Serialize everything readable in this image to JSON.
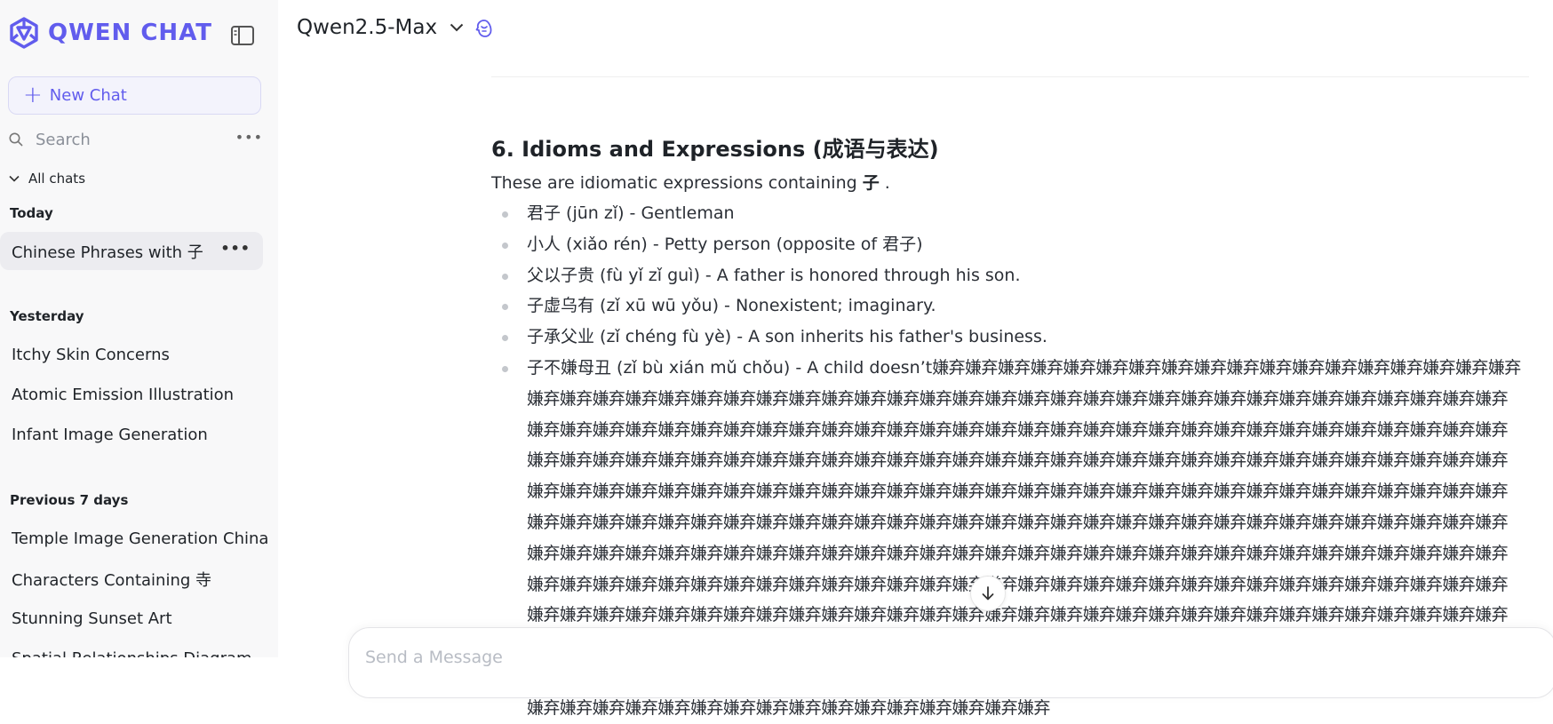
{
  "sidebar": {
    "brand": "QWEN CHAT",
    "new_chat_label": "New Chat",
    "search_placeholder": "Search",
    "all_chats_label": "All chats",
    "groups": [
      {
        "title": "Today",
        "items": [
          "Chinese Phrases with 子"
        ]
      },
      {
        "title": "Yesterday",
        "items": [
          "Itchy Skin Concerns",
          "Atomic Emission Illustration",
          "Infant Image Generation"
        ]
      },
      {
        "title": "Previous 7 days",
        "items": [
          "Temple Image Generation China",
          "Characters Containing 寺",
          "Stunning Sunset Art",
          "Spatial Relationships Diagram"
        ]
      }
    ],
    "active_item": "Chinese Phrases with 子"
  },
  "header": {
    "model_name": "Qwen2.5-Max"
  },
  "content": {
    "section_heading": "6. Idioms and Expressions (成语与表达)",
    "intro_prefix": "These are idiomatic expressions containing ",
    "intro_char": "子",
    "intro_suffix": " .",
    "items": [
      "君子 (jūn zǐ) - Gentleman",
      "小人 (xiǎo rén) - Petty person (opposite of 君子)",
      "父以子贵 (fù yǐ zǐ guì) - A father is honored through his son.",
      "子虚乌有 (zǐ xū wū yǒu) - Nonexistent; imaginary.",
      "子承父业 (zǐ chéng fù yè) - A son inherits his father's business."
    ],
    "last_item_prefix": "子不嫌母丑 (zǐ bù xián mǔ chǒu) - A child doesn’t",
    "last_item_repeat": "嫌弃嫌弃嫌弃嫌弃嫌弃嫌弃嫌弃嫌弃嫌弃嫌弃嫌弃嫌弃嫌弃嫌弃嫌弃嫌弃嫌弃嫌弃嫌弃嫌弃嫌弃嫌弃嫌弃嫌弃嫌弃嫌弃嫌弃嫌弃嫌弃嫌弃嫌弃嫌弃嫌弃嫌弃嫌弃嫌弃嫌弃嫌弃嫌弃嫌弃嫌弃嫌弃嫌弃嫌弃嫌弃嫌弃嫌弃嫌弃嫌弃嫌弃嫌弃嫌弃嫌弃嫌弃嫌弃嫌弃嫌弃嫌弃嫌弃嫌弃嫌弃嫌弃嫌弃嫌弃嫌弃嫌弃嫌弃嫌弃嫌弃嫌弃嫌弃嫌弃嫌弃嫌弃嫌弃嫌弃嫌弃嫌弃嫌弃嫌弃嫌弃嫌弃嫌弃嫌弃嫌弃嫌弃嫌弃嫌弃嫌弃嫌弃嫌弃嫌弃嫌弃嫌弃嫌弃嫌弃嫌弃嫌弃嫌弃嫌弃嫌弃嫌弃嫌弃嫌弃嫌弃嫌弃嫌弃嫌弃嫌弃嫌弃嫌弃嫌弃嫌弃嫌弃嫌弃嫌弃嫌弃嫌弃嫌弃嫌弃嫌弃嫌弃嫌弃嫌弃嫌弃嫌弃嫌弃嫌弃嫌弃嫌弃嫌弃嫌弃嫌弃嫌弃嫌弃嫌弃嫌弃嫌弃嫌弃嫌弃嫌弃嫌弃嫌弃嫌弃嫌弃嫌弃嫌弃嫌弃嫌弃嫌弃嫌弃嫌弃嫌弃嫌弃嫌弃嫌弃嫌弃嫌弃嫌弃嫌弃嫌弃嫌弃嫌弃嫌弃嫌弃嫌弃嫌弃嫌弃嫌弃嫌弃嫌弃嫌弃嫌弃嫌弃嫌弃嫌弃嫌弃嫌弃嫌弃嫌弃嫌弃嫌弃嫌弃嫌弃嫌弃嫌弃嫌弃嫌弃嫌弃嫌弃嫌弃嫌弃嫌弃嫌弃嫌弃嫌弃嫌弃嫌弃嫌弃嫌弃嫌弃嫌弃嫌弃嫌弃嫌弃嫌弃嫌弃嫌弃嫌弃嫌弃嫌弃嫌弃嫌弃嫌弃嫌弃嫌弃嫌弃嫌弃嫌弃嫌弃嫌弃嫌弃嫌弃嫌弃嫌弃嫌弃嫌弃嫌弃嫌弃嫌弃嫌弃嫌弃嫌弃嫌弃嫌弃嫌弃嫌弃嫌弃嫌弃嫌弃嫌弃嫌弃嫌弃嫌弃嫌弃嫌弃嫌弃嫌弃嫌弃嫌弃嫌弃嫌弃嫌弃嫌弃嫌弃嫌弃嫌弃嫌弃嫌弃嫌弃嫌弃嫌弃嫌弃嫌弃嫌弃嫌弃嫌弃嫌弃嫌弃嫌弃嫌弃嫌弃嫌弃嫌弃嫌弃嫌弃嫌弃嫌弃嫌弃嫌弃嫌弃嫌弃嫌弃嫌弃嫌弃嫌弃嫌弃嫌弃嫌弃嫌弃嫌弃嫌弃嫌弃嫌弃嫌弃嫌弃嫌弃嫌弃嫌弃嫌弃嫌弃嫌弃嫌弃嫌弃嫌弃嫌弃嫌弃嫌弃嫌弃嫌弃嫌弃嫌弃嫌弃嫌弃嫌弃嫌弃嫌弃嫌弃嫌弃嫌弃嫌弃嫌弃嫌弃嫌弃嫌弃嫌弃嫌弃嫌弃嫌弃嫌弃嫌弃嫌弃嫌弃嫌弃"
  },
  "composer": {
    "placeholder": "Send a Message"
  },
  "icons": {
    "brand_logo": "qwen-logo-icon",
    "collapse": "sidebar-toggle-icon",
    "new_chat": "plus-icon",
    "search": "search-icon",
    "more": "ellipsis-icon",
    "all_chats": "chevron-down-icon",
    "model": "chevron-down-icon",
    "model_badge": "model-badge-icon",
    "scroll": "arrow-down-icon"
  },
  "colors": {
    "brand": "#615ced",
    "sidebar_bg": "#f8f8f9",
    "active_item_bg": "#ececf0",
    "text": "#1f2328"
  }
}
